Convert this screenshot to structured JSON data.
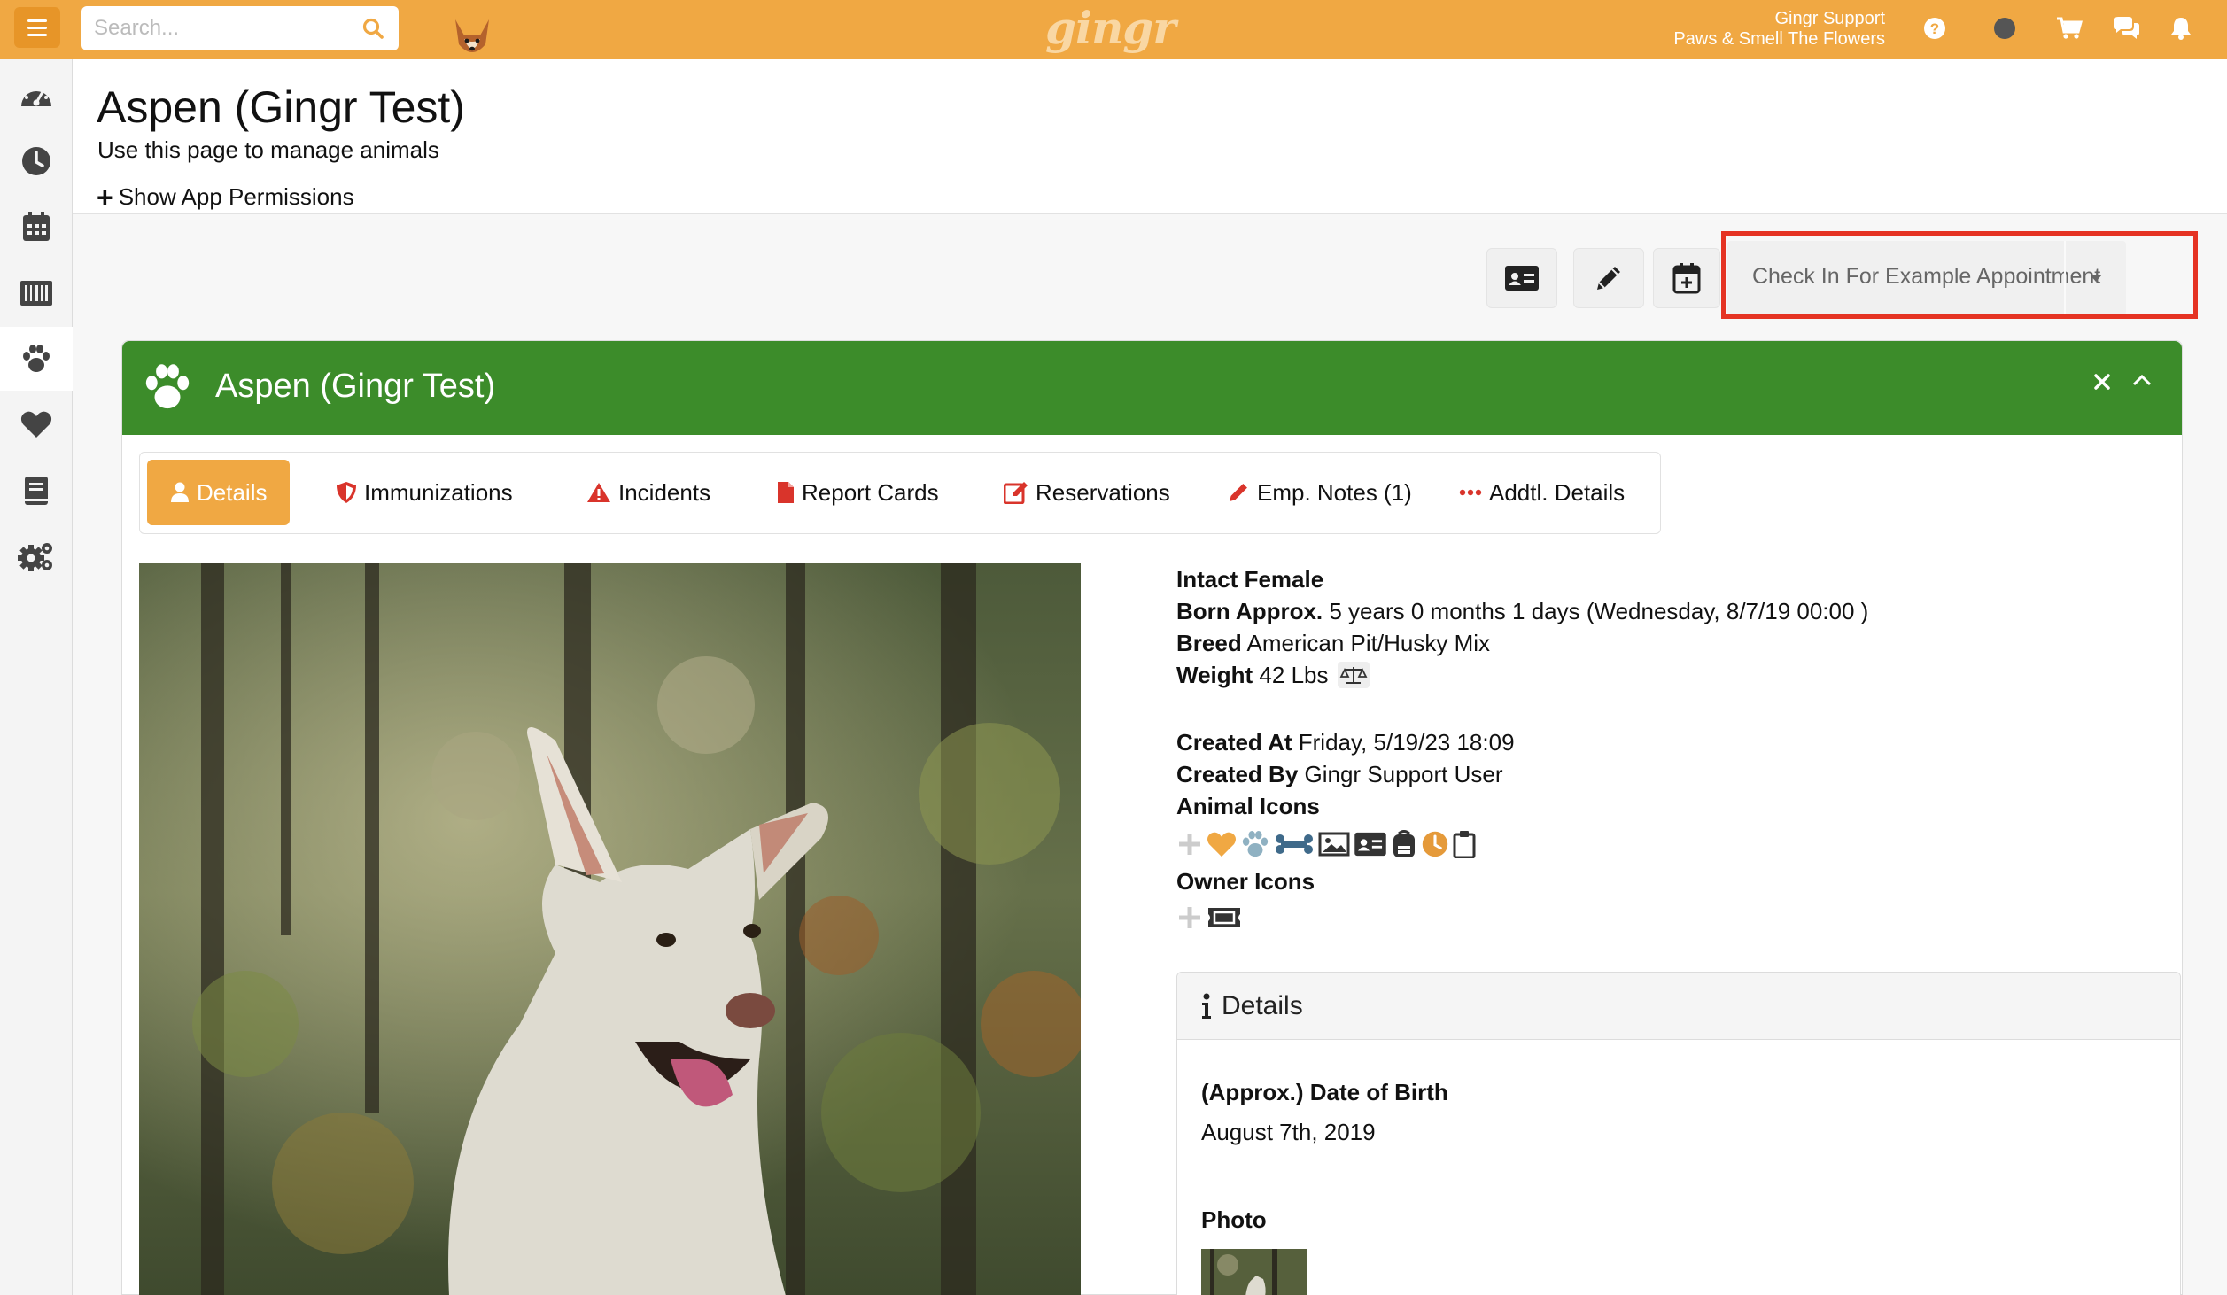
{
  "topbar": {
    "search_placeholder": "Search...",
    "logo": "gingr",
    "user_name": "Gingr Support",
    "location": "Paws & Smell The Flowers"
  },
  "page": {
    "title": "Aspen (Gingr Test)",
    "subtitle": "Use this page to manage animals",
    "permissions_link": "Show App Permissions"
  },
  "actions": {
    "check_in_label": "Check In For Example Appointment"
  },
  "panel": {
    "title": "Aspen (Gingr Test)",
    "tabs": [
      {
        "label": "Details"
      },
      {
        "label": "Immunizations"
      },
      {
        "label": "Incidents"
      },
      {
        "label": "Report Cards"
      },
      {
        "label": "Reservations"
      },
      {
        "label": "Emp. Notes (1)"
      },
      {
        "label": "Addtl. Details"
      }
    ]
  },
  "animal": {
    "sex": "Intact Female",
    "born_label": "Born Approx.",
    "born_value": "5 years 0 months 1 days (Wednesday, 8/7/19 00:00 )",
    "breed_label": "Breed",
    "breed_value": "American Pit/Husky Mix",
    "weight_label": "Weight",
    "weight_value": "42 Lbs",
    "created_at_label": "Created At",
    "created_at_value": "Friday, 5/19/23 18:09",
    "created_by_label": "Created By",
    "created_by_value": "Gingr Support User",
    "animal_icons_label": "Animal Icons",
    "owner_icons_label": "Owner Icons"
  },
  "details_card": {
    "title": "Details",
    "dob_label": "(Approx.) Date of Birth",
    "dob_value": "August 7th, 2019",
    "photo_label": "Photo"
  },
  "colors": {
    "brand_orange": "#f0a843",
    "panel_green": "#3c8c2a",
    "highlight_red": "#e53323",
    "tab_red": "#d9342b"
  }
}
